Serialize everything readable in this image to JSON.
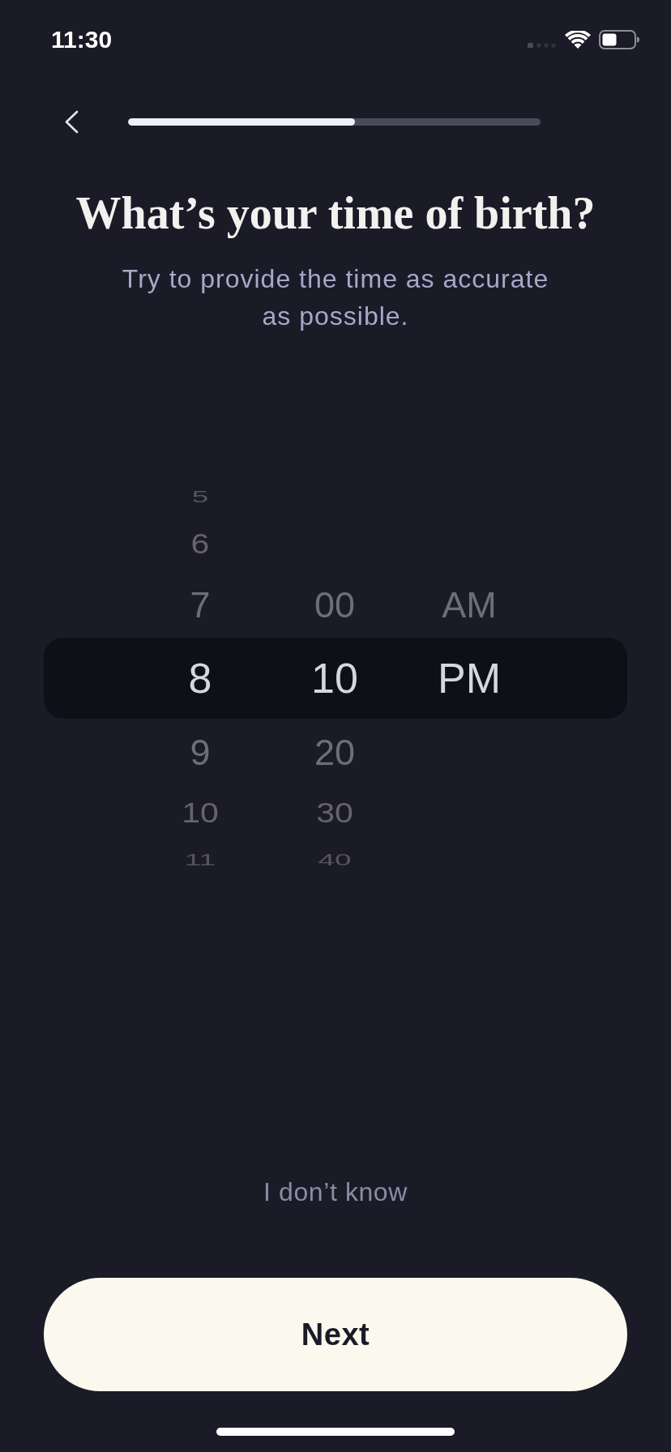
{
  "status_bar": {
    "time": "11:30"
  },
  "header": {
    "progress": {
      "level": 0.55
    }
  },
  "title": "What’s your time of birth?",
  "subtitle": "Try to provide the time as accurate as possible.",
  "picker": {
    "columns": [
      {
        "items": [
          {
            "label": "5",
            "selected": false
          },
          {
            "label": "6",
            "selected": false
          },
          {
            "label": "7",
            "selected": false
          },
          {
            "label": "8",
            "selected": true
          },
          {
            "label": "9",
            "selected": false
          },
          {
            "label": "10",
            "selected": false
          },
          {
            "label": "11",
            "selected": false
          }
        ]
      },
      {
        "items": [
          {
            "label": "00",
            "selected": false
          },
          {
            "label": "10",
            "selected": true
          },
          {
            "label": "20",
            "selected": false
          },
          {
            "label": "30",
            "selected": false
          },
          {
            "label": "40",
            "selected": false
          }
        ]
      },
      {
        "items": [
          {
            "label": "AM",
            "selected": false
          },
          {
            "label": "PM",
            "selected": true
          }
        ]
      }
    ]
  },
  "skip_link": "I don’t know",
  "next_button": "Next"
}
